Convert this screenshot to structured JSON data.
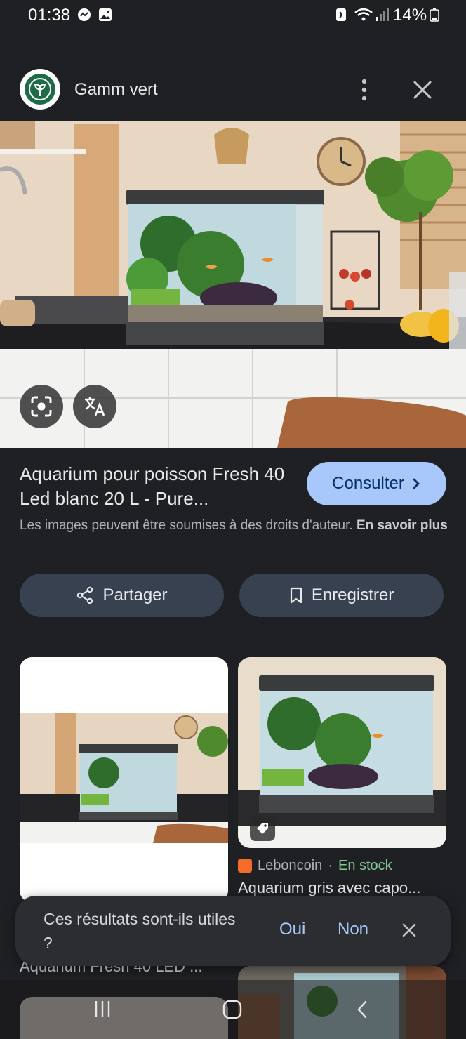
{
  "status_bar": {
    "time": "01:38",
    "battery": "14%"
  },
  "header": {
    "site_name": "Gamm vert"
  },
  "result": {
    "title": "Aquarium pour poisson Fresh 40 Led blanc 20 L - Pure...",
    "consult_label": "Consulter",
    "copyright_text": "Les images peuvent être soumises à des droits d'auteur.",
    "learn_more": "En savoir plus",
    "share_label": "Partager",
    "save_label": "Enregistrer"
  },
  "related": {
    "right": {
      "source": "Leboncoin",
      "separator": "·",
      "availability": "En stock",
      "title": "Aquarium gris avec capo..."
    },
    "left": {
      "title": "Aquarium Fresh 40 LED ..."
    }
  },
  "feedback": {
    "question": "Ces résultats sont-ils utiles ?",
    "yes": "Oui",
    "no": "Non"
  },
  "colors": {
    "accent": "#a8c7fa",
    "background": "#1f2023",
    "in_stock": "#81c995",
    "button_bg": "#38414f"
  },
  "icons": [
    "message-icon",
    "gallery-icon",
    "nfc-icon",
    "wifi-icon",
    "signal-icon",
    "battery-icon",
    "more-vert-icon",
    "close-icon",
    "lens-icon",
    "translate-icon",
    "share-icon",
    "bookmark-icon",
    "chevron-right-icon",
    "tag-icon",
    "recents-icon",
    "home-icon",
    "back-icon"
  ]
}
